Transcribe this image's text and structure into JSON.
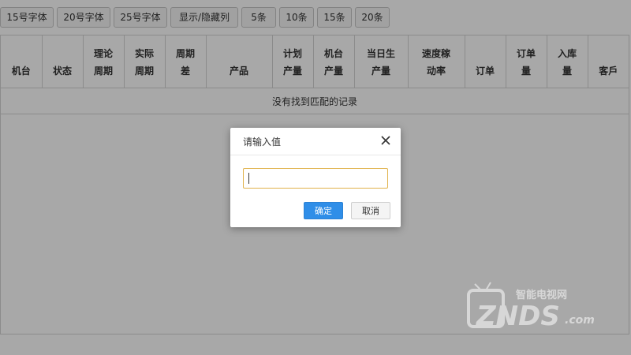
{
  "toolbar": {
    "buttons": [
      "15号字体",
      "20号字体",
      "25号字体",
      "显示/隐藏列",
      "5条",
      "10条",
      "15条",
      "20条"
    ]
  },
  "table": {
    "columns": [
      "机台",
      "状态",
      "理论\n周期",
      "实际\n周期",
      "周期\n差",
      "产品",
      "计划\n产量",
      "机台\n产量",
      "当日生\n产量",
      "速度稼\n动率",
      "订单",
      "订单\n量",
      "入库\n量",
      "客戶"
    ],
    "empty_text": "没有找到匹配的记录"
  },
  "dialog": {
    "title": "请输入值",
    "input_value": "",
    "ok_label": "确定",
    "cancel_label": "取消"
  },
  "watermark": {
    "brand_cn": "智能电视网",
    "brand": "ZNDS",
    "domain": ".com"
  },
  "colors": {
    "primary": "#2f8ee8",
    "focus_border": "#e0b24b",
    "overlay": "rgba(0,0,0,0.34)"
  }
}
